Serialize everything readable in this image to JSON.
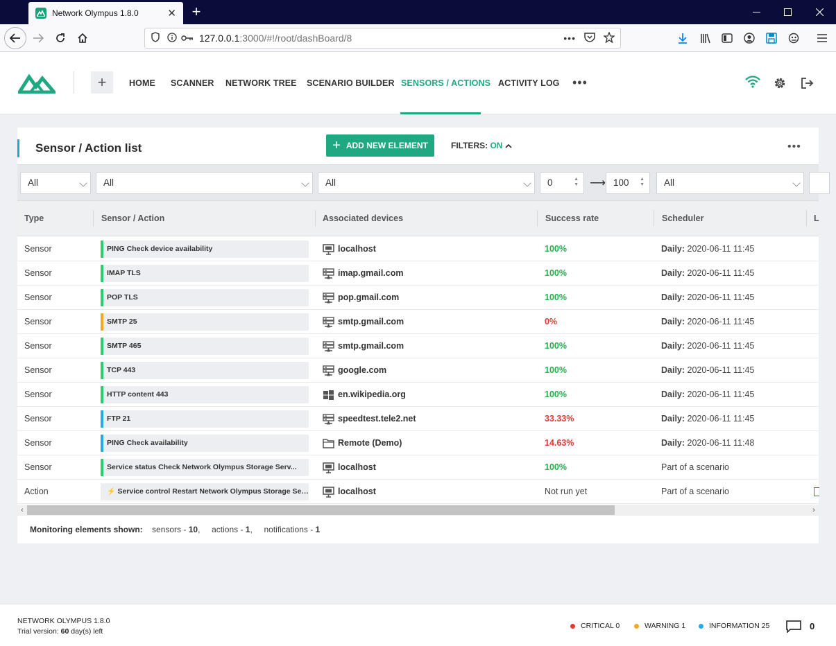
{
  "browser": {
    "tab_title": "Network Olympus 1.8.0",
    "url_host": "127.0.0.1",
    "url_rest": ":3000/#!/root/dashBoard/8"
  },
  "app": {
    "menu": [
      "HOME",
      "SCANNER",
      "NETWORK TREE",
      "SCENARIO BUILDER",
      "SENSORS / ACTIONS",
      "ACTIVITY LOG"
    ],
    "active_menu": "SENSORS / ACTIONS",
    "accent_color": "#1fa882"
  },
  "card": {
    "title": "Sensor / Action list",
    "add_button": "ADD NEW ELEMENT",
    "filters_label": "FILTERS:",
    "filters_state": "ON"
  },
  "filters": {
    "type": "All",
    "sensor": "All",
    "devices": "All",
    "rate_min": "0",
    "rate_max": "100",
    "scheduler": "All"
  },
  "columns": [
    "Type",
    "Sensor / Action",
    "Associated devices",
    "Success rate",
    "Scheduler",
    "L"
  ],
  "rows": [
    {
      "type": "Sensor",
      "name": "PING Check device availability",
      "status_color": "#2ecc71",
      "device_icon": "computer-icon",
      "device": "localhost",
      "rate": "100%",
      "rate_color": "#22b14c",
      "sched_prefix": "Daily:",
      "sched": "2020-06-11 11:45"
    },
    {
      "type": "Sensor",
      "name": "IMAP TLS",
      "status_color": "#2ecc71",
      "device_icon": "server-icon",
      "device": "imap.gmail.com",
      "rate": "100%",
      "rate_color": "#22b14c",
      "sched_prefix": "Daily:",
      "sched": "2020-06-11 11:45"
    },
    {
      "type": "Sensor",
      "name": "POP TLS",
      "status_color": "#2ecc71",
      "device_icon": "server-icon",
      "device": "pop.gmail.com",
      "rate": "100%",
      "rate_color": "#22b14c",
      "sched_prefix": "Daily:",
      "sched": "2020-06-11 11:45"
    },
    {
      "type": "Sensor",
      "name": "SMTP 25",
      "status_color": "#f5a623",
      "device_icon": "server-icon",
      "device": "smtp.gmail.com",
      "rate": "0%",
      "rate_color": "#e53935",
      "sched_prefix": "Daily:",
      "sched": "2020-06-11 11:45"
    },
    {
      "type": "Sensor",
      "name": "SMTP 465",
      "status_color": "#2ecc71",
      "device_icon": "server-icon",
      "device": "smtp.gmail.com",
      "rate": "100%",
      "rate_color": "#22b14c",
      "sched_prefix": "Daily:",
      "sched": "2020-06-11 11:45"
    },
    {
      "type": "Sensor",
      "name": "TCP 443",
      "status_color": "#2ecc71",
      "device_icon": "server-icon",
      "device": "google.com",
      "rate": "100%",
      "rate_color": "#22b14c",
      "sched_prefix": "Daily:",
      "sched": "2020-06-11 11:45"
    },
    {
      "type": "Sensor",
      "name": "HTTP content 443",
      "status_color": "#2ecc71",
      "device_icon": "windows-icon",
      "device": "en.wikipedia.org",
      "rate": "100%",
      "rate_color": "#22b14c",
      "sched_prefix": "Daily:",
      "sched": "2020-06-11 11:45"
    },
    {
      "type": "Sensor",
      "name": "FTP 21",
      "status_color": "#29a8e8",
      "device_icon": "server-icon",
      "device": "speedtest.tele2.net",
      "rate": "33.33%",
      "rate_color": "#e53935",
      "sched_prefix": "Daily:",
      "sched": "2020-06-11 11:45"
    },
    {
      "type": "Sensor",
      "name": "PING Check availability",
      "status_color": "#29a8e8",
      "device_icon": "folder-icon",
      "device": "Remote (Demo)",
      "rate": "14.63%",
      "rate_color": "#e53935",
      "sched_prefix": "Daily:",
      "sched": "2020-06-11 11:48"
    },
    {
      "type": "Sensor",
      "name": "Service status Check Network Olympus Storage Serv...",
      "status_color": "#2ecc71",
      "device_icon": "computer-icon",
      "device": "localhost",
      "rate": "100%",
      "rate_color": "#22b14c",
      "sched_prefix": "",
      "sched": "Part of a scenario"
    },
    {
      "type": "Action",
      "name": "Service control Restart Network Olympus Storage Ser...",
      "status_color": "",
      "device_icon": "computer-icon",
      "device": "localhost",
      "rate": "Not run yet",
      "rate_color": "#444444",
      "sched_prefix": "",
      "sched": "Part of a scenario"
    }
  ],
  "summary": {
    "label": "Monitoring elements shown:",
    "sensors_label": "sensors -",
    "sensors": "10",
    "actions_label": "actions -",
    "actions": "1",
    "notifications_label": "notifications -",
    "notifications": "1"
  },
  "footer": {
    "product": "NETWORK OLYMPUS 1.8.0",
    "trial_prefix": "Trial version:",
    "trial_days": "60",
    "trial_suffix": "day(s) left",
    "critical": "CRITICAL 0",
    "warning": "WARNING 1",
    "information": "INFORMATION 25",
    "messages": "0",
    "critical_color": "#e53935",
    "warning_color": "#f5a623",
    "info_color": "#29a8e8"
  }
}
